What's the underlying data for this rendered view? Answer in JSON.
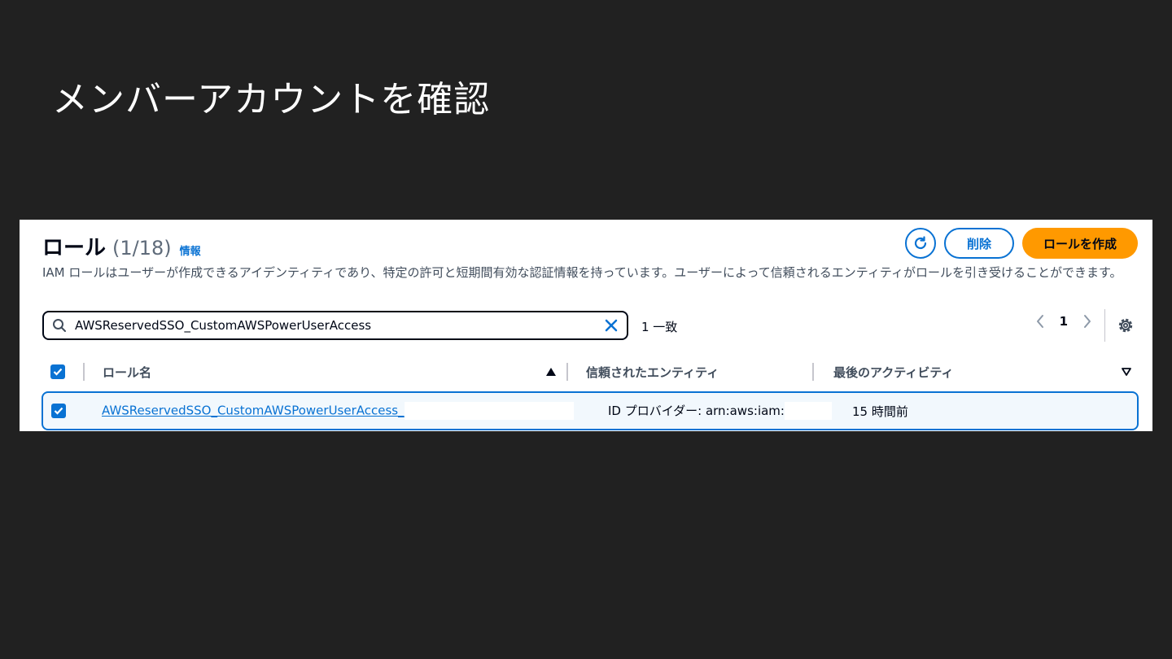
{
  "slide": {
    "title": "メンバーアカウントを確認"
  },
  "panel": {
    "title": "ロール",
    "count": "(1/18)",
    "info_link": "情報",
    "description": "IAM ロールはユーザーが作成できるアイデンティティであり、特定の許可と短期間有効な認証情報を持っています。ユーザーによって信頼されるエンティティがロールを引き受けることができます。",
    "actions": {
      "refresh_icon": "refresh-icon",
      "delete_label": "削除",
      "create_label": "ロールを作成"
    },
    "search": {
      "value": "AWSReservedSSO_CustomAWSPowerUserAccess",
      "match_count": "1 一致"
    },
    "pagination": {
      "current_page": "1"
    },
    "table": {
      "columns": [
        "ロール名",
        "信頼されたエンティティ",
        "最後のアクティビティ"
      ],
      "rows": [
        {
          "role_name": "AWSReservedSSO_CustomAWSPowerUserAccess_",
          "trusted_entity": "ID プロバイダー: arn:aws:iam:",
          "last_activity": "15 時間前",
          "selected": true
        }
      ]
    },
    "colors": {
      "link": "#0972d3",
      "primary_button": "#ff9900",
      "background": "#212121"
    }
  }
}
